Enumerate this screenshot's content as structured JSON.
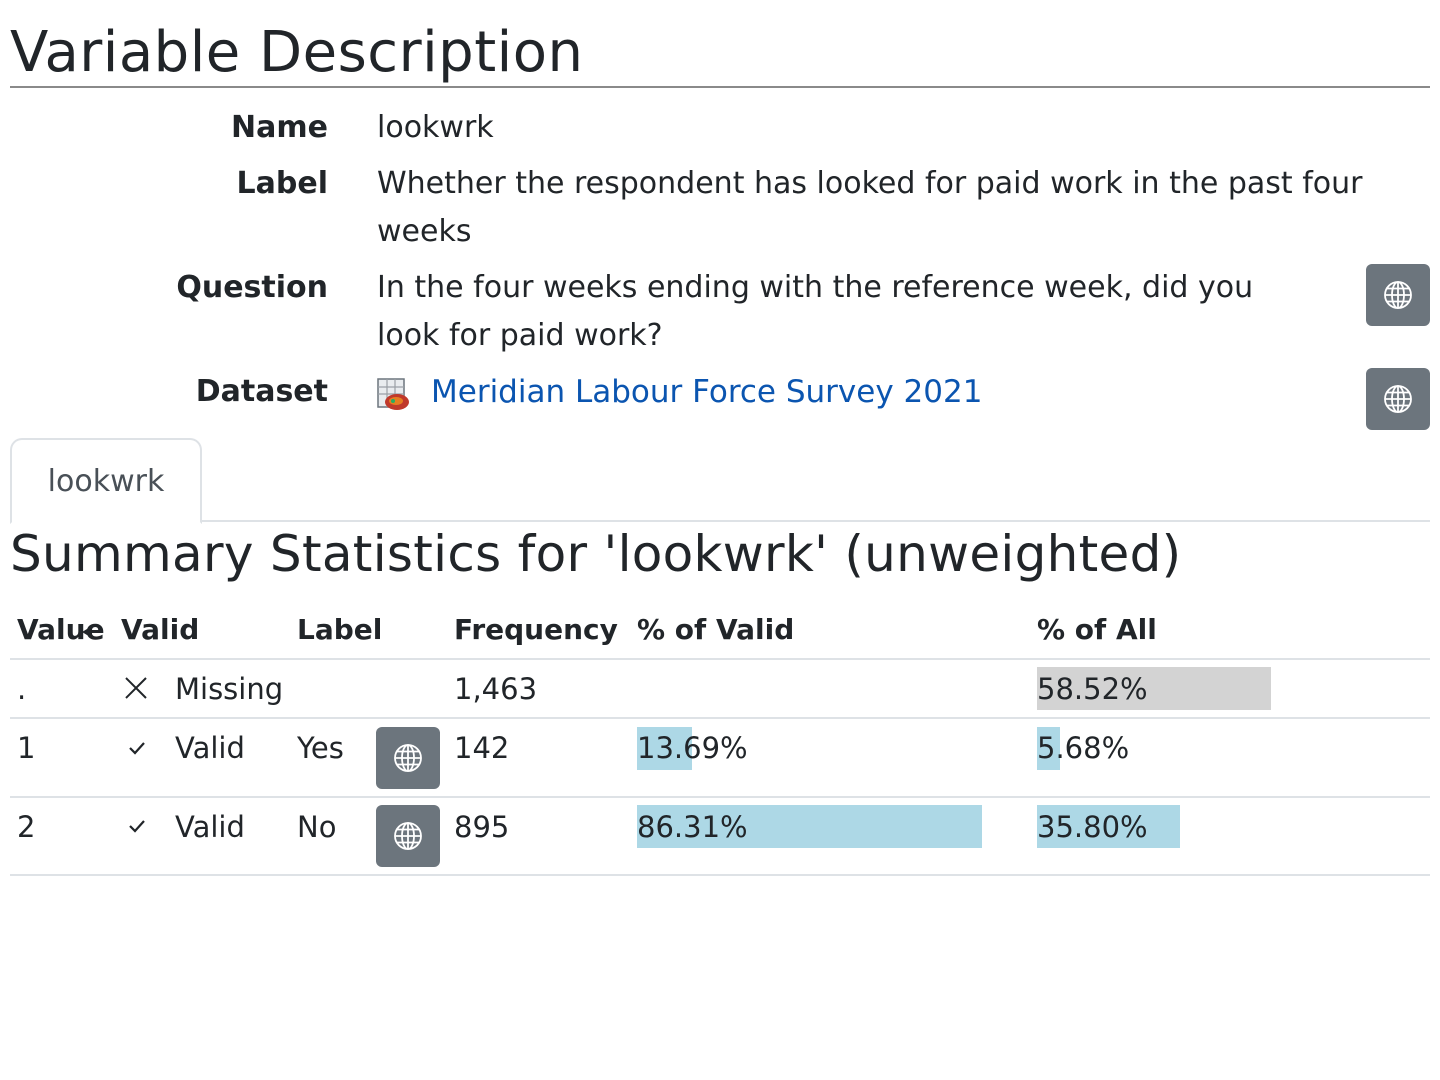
{
  "page": {
    "title": "Variable Description"
  },
  "meta": {
    "name_label": "Name",
    "name_value": "lookwrk",
    "label_label": "Label",
    "label_value_line1": "Whether the respondent has looked for paid work in the past four",
    "label_value_line2": "weeks",
    "question_label": "Question",
    "question_value_line1": "In the four weeks ending with the reference week, did you",
    "question_value_line2": "look for paid work?",
    "dataset_label": "Dataset",
    "dataset_link": "Meridian Labour Force Survey 2021"
  },
  "tabs": [
    {
      "label": "lookwrk"
    }
  ],
  "summary": {
    "title": "Summary Statistics for 'lookwrk' (unweighted)",
    "columns": [
      "Value",
      "Valid",
      "Label",
      "Frequency",
      "% of Valid",
      "% of All"
    ],
    "rows": [
      {
        "value": ".",
        "valid_icon": "cross-icon",
        "valid": "Missing",
        "label": "",
        "frequency": "1,463",
        "pct_valid": "",
        "pct_all": "58.52%",
        "pct_valid_num": 0,
        "pct_all_num": 58.52
      },
      {
        "value": "1",
        "valid_icon": "check-icon",
        "valid": "Valid",
        "label": "Yes",
        "frequency": "142",
        "pct_valid": "13.69%",
        "pct_all": "5.68%",
        "pct_valid_num": 13.69,
        "pct_all_num": 5.68
      },
      {
        "value": "2",
        "valid_icon": "check-icon",
        "valid": "Valid",
        "label": "No",
        "frequency": "895",
        "pct_valid": "86.31%",
        "pct_all": "35.80%",
        "pct_valid_num": 86.31,
        "pct_all_num": 35.8
      }
    ]
  },
  "colors": {
    "bar_valid": "#add8e6",
    "bar_missing": "#d3d3d3",
    "button": "#6c757d",
    "link": "#0b55b0"
  }
}
